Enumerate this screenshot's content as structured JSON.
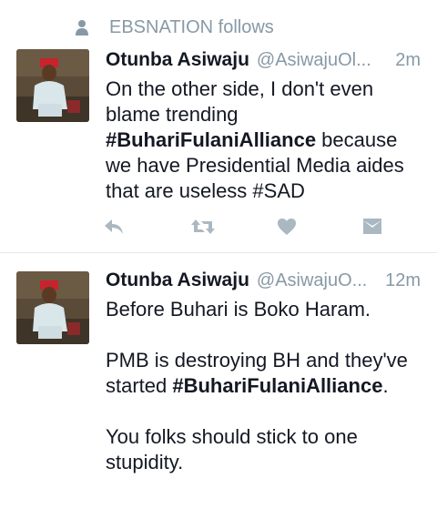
{
  "context": {
    "text": "EBSNATION follows",
    "icon": "person-icon"
  },
  "tweets": [
    {
      "name": "Otunba Asiwaju",
      "handle": "@AsiwajuOl...",
      "time": "2m",
      "text_parts": {
        "line1": "On the other side, I don't even blame trending ",
        "hashtag1": "#BuhariFulaniAlliance",
        "line2": " because we have Presidential Media aides that are useless #SAD"
      },
      "actions": {
        "reply_icon": "reply-icon",
        "retweet_icon": "retweet-icon",
        "like_icon": "heart-icon",
        "dm_icon": "envelope-icon"
      }
    },
    {
      "name": "Otunba Asiwaju",
      "handle": "@AsiwajuO...",
      "time": "12m",
      "paragraphs": {
        "p1": "Before Buhari is Boko Haram.",
        "p2_pre": "PMB is destroying BH and they've started ",
        "p2_hashtag": "#BuhariFulaniAlliance",
        "p2_post": ".",
        "p3": "You folks should stick to one stupidity."
      }
    }
  ],
  "colors": {
    "text": "#141823",
    "muted": "#8899a6",
    "divider": "#e1e8ed",
    "icon": "#aab8c2"
  }
}
